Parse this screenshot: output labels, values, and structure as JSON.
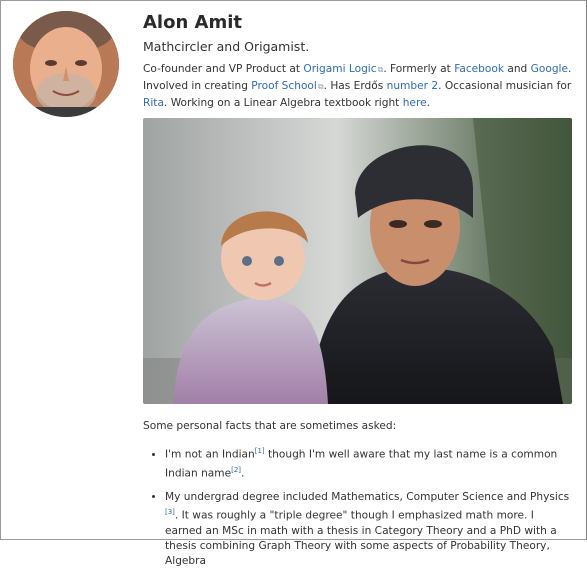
{
  "profile": {
    "name": "Alon Amit",
    "subtitle": "Mathcircler and Origamist."
  },
  "bio": {
    "p1": "Co-founder and VP Product at ",
    "link_origami": "Origami Logic",
    "p2": ". Formerly at ",
    "link_facebook": "Facebook",
    "p3": " and ",
    "link_google": "Google",
    "p4": ". Involved in creating ",
    "link_proof": "Proof School",
    "p5": ". Has Erdős ",
    "link_number": "number 2",
    "p6": ". Occasional musician for ",
    "link_rita": "Rita",
    "p7": ". Working on a Linear Algebra textbook right ",
    "link_here": "here",
    "p8": "."
  },
  "facts": {
    "intro": "Some personal facts that are sometimes asked:",
    "item1_a": "I'm not an Indian",
    "item1_ref1": "[1]",
    "item1_b": " though I'm well aware that my last name is a common Indian name",
    "item1_ref2": "[2]",
    "item1_c": ".",
    "item2_a": "My undergrad degree included Mathematics, Computer Science and Physics ",
    "item2_ref": "[3]",
    "item2_b": ". It was roughly a \"triple degree\" though I emphasized math more. I earned an MSc in math with a thesis in Category Theory and a PhD with a thesis combining Graph Theory with some aspects of Probability Theory, Algebra"
  },
  "icons": {
    "external": "external-link-icon"
  },
  "colors": {
    "link": "#2f6cb0"
  }
}
